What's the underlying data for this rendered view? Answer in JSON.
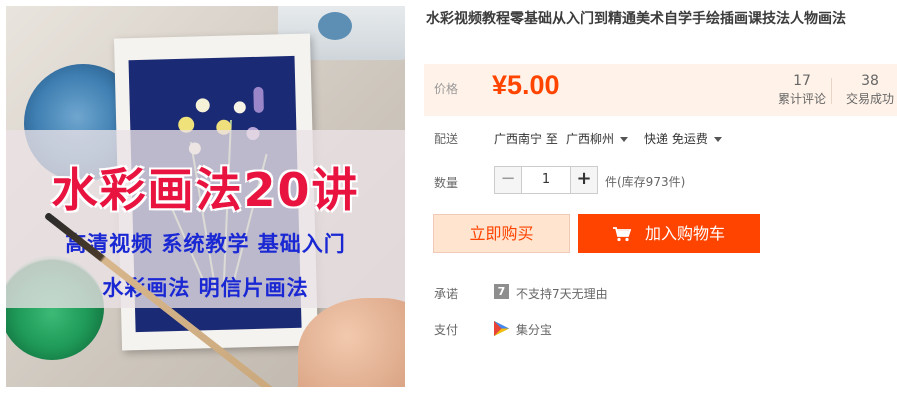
{
  "image": {
    "banner_title": "水彩画法20讲",
    "banner_line_1": "高清视频  系统教学  基础入门",
    "banner_line_2": "水彩画法  明信片画法",
    "colors": {
      "title_red": "#e8133f",
      "line_blue": "#1a28d4"
    }
  },
  "product": {
    "title": "水彩视频教程零基础从入门到精通美术自学手绘插画课技法人物画法"
  },
  "price": {
    "label": "价格",
    "value": "¥5.00",
    "reviews_count": "17",
    "reviews_label": "累计评论",
    "deals_count": "38",
    "deals_label": "交易成功"
  },
  "shipping": {
    "label": "配送",
    "from": "广西南宁 至",
    "to": "广西柳州",
    "method": "快递 免运费"
  },
  "quantity": {
    "label": "数量",
    "minus": "−",
    "value": "1",
    "plus": "+",
    "unit_stock": "件(库存973件)"
  },
  "actions": {
    "buy_now": "立即购买",
    "add_to_cart": "加入购物车"
  },
  "promise": {
    "label": "承诺",
    "badge": "7",
    "text": "不支持7天无理由"
  },
  "payment": {
    "label": "支付",
    "icon": "jifenbao-icon",
    "text": "集分宝"
  },
  "theme": {
    "accent": "#ff4400",
    "price_bg": "#fff2e8"
  }
}
